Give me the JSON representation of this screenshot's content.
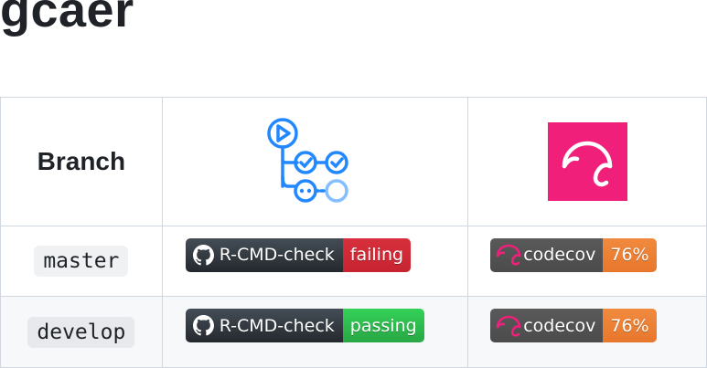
{
  "title": "gcaer",
  "table": {
    "header": {
      "branch_label": "Branch",
      "actions_icon": "github-actions-icon",
      "codecov_icon": "codecov-icon"
    },
    "rows": [
      {
        "branch": "master",
        "check": {
          "label": "R-CMD-check",
          "status": "failing",
          "status_color": "#cb2431"
        },
        "coverage": {
          "label": "codecov",
          "value": "76%",
          "color": "#ed7b32"
        }
      },
      {
        "branch": "develop",
        "check": {
          "label": "R-CMD-check",
          "status": "passing",
          "status_color": "#2ea44f"
        },
        "coverage": {
          "label": "codecov",
          "value": "76%",
          "color": "#ed7b32"
        }
      }
    ]
  },
  "colors": {
    "actions_blue": "#2188ff",
    "codecov_pink": "#f01f7a"
  }
}
